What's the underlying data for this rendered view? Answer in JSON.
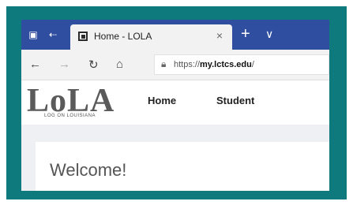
{
  "browser": {
    "tab_title": "Home - LOLA",
    "tab_close": "×",
    "new_tab": "+",
    "tab_menu": "∨",
    "url_prefix": "https://",
    "url_domain": "my.lctcs.edu",
    "url_suffix": "/"
  },
  "site": {
    "logo_text": "LoLA",
    "logo_subtext": "LOG ON LOUISIANA",
    "nav": {
      "home": "Home",
      "student": "Student"
    }
  },
  "main": {
    "heading": "Welcome!"
  }
}
